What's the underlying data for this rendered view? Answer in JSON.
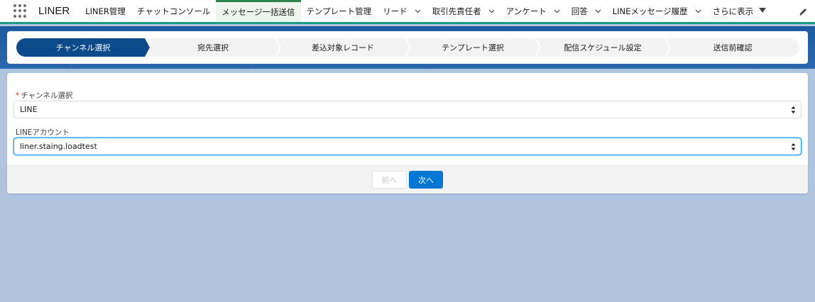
{
  "app": {
    "name": "LINER"
  },
  "nav": {
    "items": [
      {
        "label": "LINER管理",
        "dropdown": false,
        "active": false
      },
      {
        "label": "チャットコンソール",
        "dropdown": false,
        "active": false
      },
      {
        "label": "メッセージ一括送信",
        "dropdown": false,
        "active": true
      },
      {
        "label": "テンプレート管理",
        "dropdown": false,
        "active": false
      },
      {
        "label": "リード",
        "dropdown": true,
        "active": false
      },
      {
        "label": "取引先責任者",
        "dropdown": true,
        "active": false
      },
      {
        "label": "アンケート",
        "dropdown": true,
        "active": false
      },
      {
        "label": "回答",
        "dropdown": true,
        "active": false
      },
      {
        "label": "LINEメッセージ履歴",
        "dropdown": true,
        "active": false
      }
    ],
    "more_label": "さらに表示"
  },
  "path": {
    "steps": [
      {
        "label": "チャンネル選択",
        "current": true
      },
      {
        "label": "宛先選択",
        "current": false
      },
      {
        "label": "差込対象レコード",
        "current": false
      },
      {
        "label": "テンプレート選択",
        "current": false
      },
      {
        "label": "配信スケジュール設定",
        "current": false
      },
      {
        "label": "送信前確認",
        "current": false
      }
    ]
  },
  "form": {
    "channel": {
      "required_mark": "*",
      "label": "チャンネル選択",
      "value": "LINE"
    },
    "account": {
      "label": "LINEアカウント",
      "value": "liner.staing.loadtest"
    }
  },
  "footer": {
    "prev_label": "前へ",
    "next_label": "次へ"
  },
  "colors": {
    "nav_active_border": "#2e844a",
    "path_current": "#0b4a8b",
    "primary_button": "#0176d3",
    "banner": "#1e5aa0",
    "page_background": "#b0c4df"
  }
}
